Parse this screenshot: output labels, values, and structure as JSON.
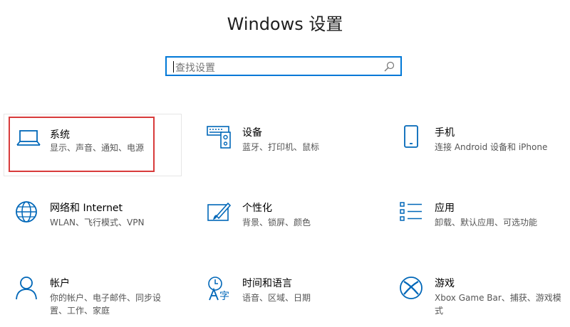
{
  "window": {
    "title": "Windows 设置"
  },
  "search": {
    "placeholder": "查找设置"
  },
  "colors": {
    "accent": "#0078d7",
    "highlight": "#d83b3b",
    "icon": "#0067b8"
  },
  "tiles": [
    {
      "name": "系统",
      "desc": "显示、声音、通知、电源",
      "icon": "laptop-icon"
    },
    {
      "name": "设备",
      "desc": "蓝牙、打印机、鼠标",
      "icon": "keyboard-speaker-icon"
    },
    {
      "name": "手机",
      "desc": "连接 Android 设备和 iPhone",
      "icon": "phone-icon"
    },
    {
      "name": "网络和 Internet",
      "desc": "WLAN、飞行模式、VPN",
      "icon": "globe-icon"
    },
    {
      "name": "个性化",
      "desc": "背景、锁屏、颜色",
      "icon": "paint-brush-icon"
    },
    {
      "name": "应用",
      "desc": "卸载、默认应用、可选功能",
      "icon": "apps-list-icon"
    },
    {
      "name": "帐户",
      "desc": "你的帐户、电子邮件、同步设置、工作、家庭",
      "icon": "person-icon"
    },
    {
      "name": "时间和语言",
      "desc": "语音、区域、日期",
      "icon": "time-language-icon"
    },
    {
      "name": "游戏",
      "desc": "Xbox Game Bar、捕获、游戏模式",
      "icon": "xbox-icon"
    }
  ]
}
